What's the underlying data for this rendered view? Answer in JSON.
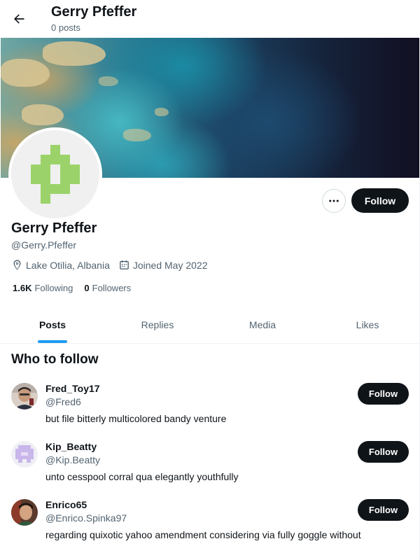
{
  "header": {
    "title": "Gerry Pfeffer",
    "post_count": "0 posts",
    "back_icon": "arrow-left-icon"
  },
  "profile": {
    "display_name": "Gerry Pfeffer",
    "handle": "@Gerry.Pfeffer",
    "location": "Lake Otilia, Albania",
    "joined": "Joined May 2022",
    "following_count": "1.6K",
    "following_label": "Following",
    "followers_count": "0",
    "followers_label": "Followers",
    "follow_label": "Follow",
    "avatar_color": "#9bd36a"
  },
  "tabs": [
    {
      "label": "Posts",
      "active": true
    },
    {
      "label": "Replies",
      "active": false
    },
    {
      "label": "Media",
      "active": false
    },
    {
      "label": "Likes",
      "active": false
    }
  ],
  "who_to_follow": {
    "title": "Who to follow",
    "suggestions": [
      {
        "name": "Fred_Toy17",
        "handle": "@Fred6",
        "bio": "but file bitterly multicolored bandy venture",
        "follow_label": "Follow"
      },
      {
        "name": "Kip_Beatty",
        "handle": "@Kip.Beatty",
        "bio": "unto cesspool corral qua elegantly youthfully",
        "follow_label": "Follow"
      },
      {
        "name": "Enrico65",
        "handle": "@Enrico.Spinka97",
        "bio": "regarding quixotic yahoo amendment considering via fully goggle without",
        "follow_label": "Follow"
      }
    ]
  },
  "colors": {
    "accent": "#1d9bf0",
    "button_dark": "#0f1419",
    "secondary_text": "#536471"
  }
}
